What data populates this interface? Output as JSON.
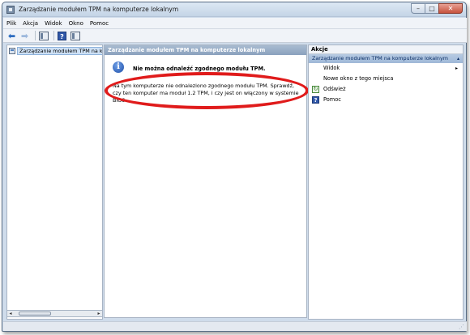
{
  "window": {
    "title": "Zarządzanie modułem TPM na komputerze lokalnym",
    "buttons": {
      "minimize": "–",
      "maximize": "□",
      "close": "✕"
    }
  },
  "menubar": {
    "items": [
      "Plik",
      "Akcja",
      "Widok",
      "Okno",
      "Pomoc"
    ]
  },
  "toolbar": {
    "icons": [
      "back-arrow-icon",
      "forward-arrow-icon",
      "show-hide-console-tree-icon",
      "help-icon",
      "show-hide-action-pane-icon"
    ],
    "back_glyph": "⬅",
    "forward_glyph": "➡",
    "help_glyph": "?"
  },
  "tree": {
    "items": [
      {
        "label": "Zarządzanie modułem TPM na komputerze lokalnym"
      }
    ]
  },
  "scrollbar": {
    "left_arrow": "◂",
    "right_arrow": "▸"
  },
  "main": {
    "header": "Zarządzanie modułem TPM na komputerze lokalnym",
    "info_glyph": "i",
    "message_title": "Nie można odnaleźć zgodnego modułu TPM.",
    "message_body": "Na tym komputerze nie odnaleziono zgodnego modułu TPM. Sprawdź, czy ten komputer ma moduł 1.2 TPM, i czy jest on włączony w systemie BIOS."
  },
  "actions": {
    "header": "Akcje",
    "section_title": "Zarządzanie modułem TPM na komputerze lokalnym",
    "section_caret": "▴",
    "submenu_arrow": "▸",
    "refresh_glyph": "↻",
    "help_glyph": "?",
    "items": [
      {
        "label": "Widok",
        "has_submenu": true,
        "icon": ""
      },
      {
        "label": "Nowe okno z tego miejsca",
        "has_submenu": false,
        "icon": ""
      },
      {
        "label": "Odśwież",
        "has_submenu": false,
        "icon": "refresh-icon"
      },
      {
        "label": "Pomoc",
        "has_submenu": false,
        "icon": "help-icon"
      }
    ]
  },
  "statusbar": {
    "grip": "⋰"
  },
  "colors": {
    "highlight_ellipse": "#e01b1b",
    "pane_header": "#8aa1bd",
    "selection": "#cde0f5"
  }
}
